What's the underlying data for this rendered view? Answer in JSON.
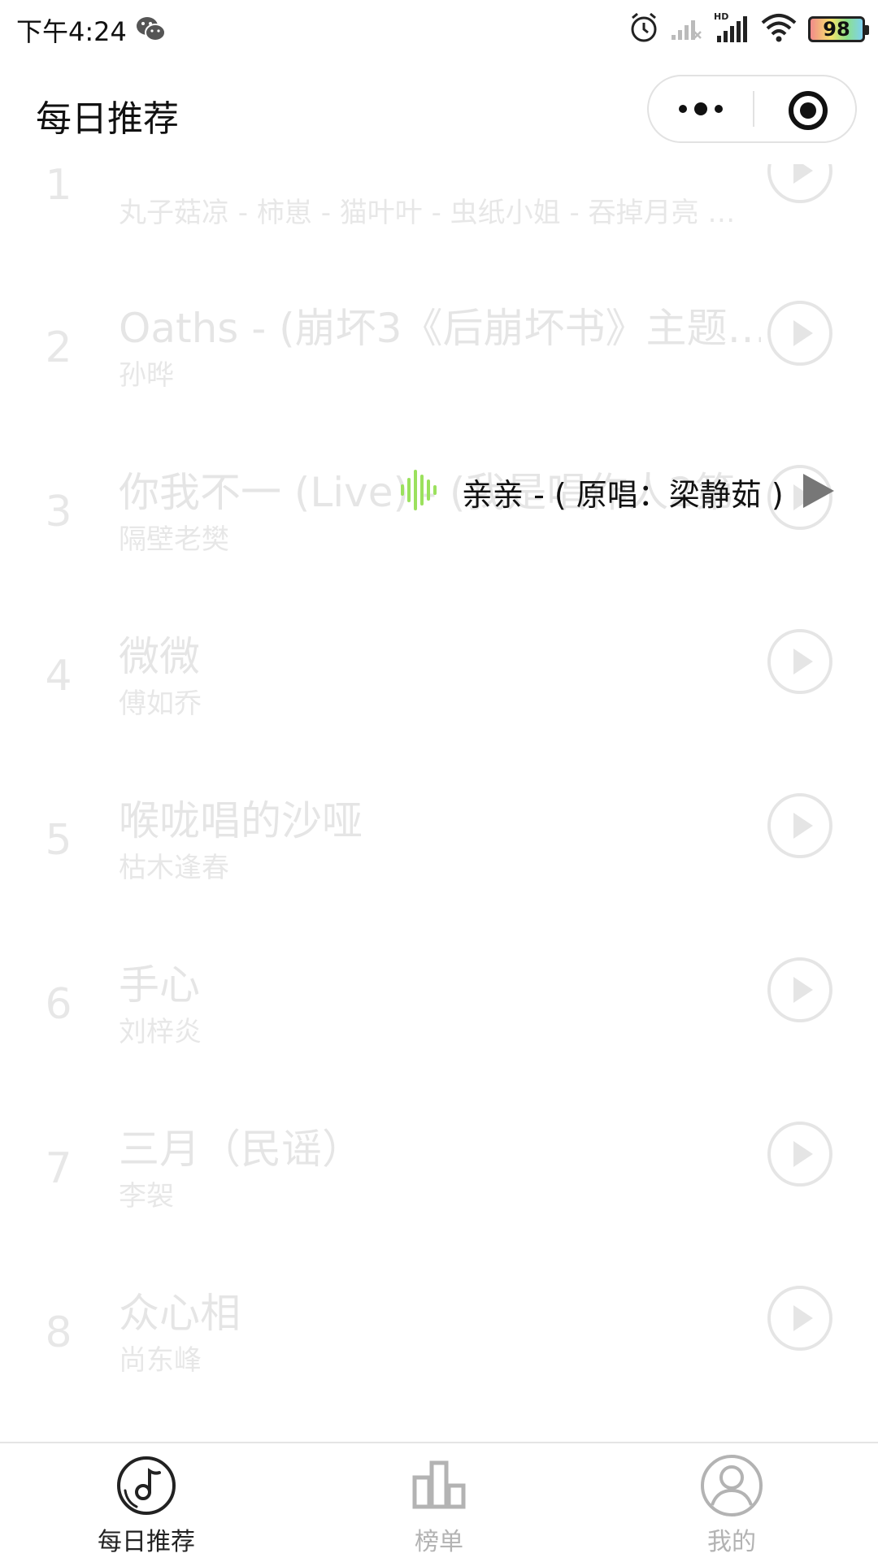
{
  "status_bar": {
    "time": "下午4:24",
    "battery": "98"
  },
  "title_bar": {
    "title": "每日推荐"
  },
  "songs": [
    {
      "rank": "1",
      "title": "",
      "artist": "丸子菇凉 - 柿崽 - 猫叶叶 - 虫纸小姐 - 吞掉月亮 …"
    },
    {
      "rank": "2",
      "title": "Oaths - (崩坏3《后崩坏书》主题…",
      "artist": "孙晔"
    },
    {
      "rank": "3",
      "title": "你我不一 (Live) - (我是唱作人2第…",
      "artist": "隔壁老樊"
    },
    {
      "rank": "4",
      "title": "微微",
      "artist": "傅如乔"
    },
    {
      "rank": "5",
      "title": "喉咙唱的沙哑",
      "artist": "枯木逢春"
    },
    {
      "rank": "6",
      "title": "手心",
      "artist": "刘梓炎"
    },
    {
      "rank": "7",
      "title": "三月（民谣）",
      "artist": "李袈"
    },
    {
      "rank": "8",
      "title": "众心相",
      "artist": "尚东峰"
    }
  ],
  "now_playing": {
    "title": "亲亲 - ( 原唱：梁静茹 )",
    "accent_color": "#9be15d"
  },
  "tabs": [
    {
      "label": "每日推荐",
      "icon": "music-disc-icon",
      "active": true
    },
    {
      "label": "榜单",
      "icon": "chart-bars-icon",
      "active": false
    },
    {
      "label": "我的",
      "icon": "user-icon",
      "active": false
    }
  ]
}
